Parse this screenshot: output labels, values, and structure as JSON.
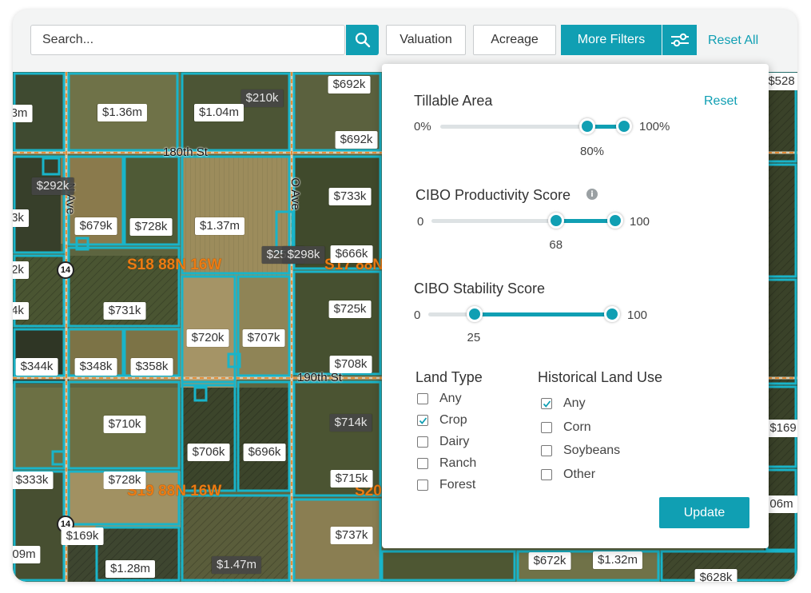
{
  "toolbar": {
    "search_placeholder": "Search...",
    "valuation_label": "Valuation",
    "acreage_label": "Acreage",
    "more_filters_label": "More Filters",
    "reset_all_label": "Reset All"
  },
  "map": {
    "roads": [
      "180th St",
      "190th St",
      "N Ave",
      "O Ave"
    ],
    "sections": [
      "S18 88N 16W",
      "S17 88N",
      "S19 88N 16W",
      "S20"
    ],
    "highway_shield": "14",
    "price_tags": [
      {
        "label": "$692k",
        "dark": false
      },
      {
        "label": "$528",
        "dark": false
      },
      {
        "label": "$210k",
        "dark": true
      },
      {
        "label": "3m",
        "dark": false
      },
      {
        "label": "$1.36m",
        "dark": false
      },
      {
        "label": "$1.04m",
        "dark": false
      },
      {
        "label": "$692k",
        "dark": false
      },
      {
        "label": "$292k",
        "dark": true
      },
      {
        "label": "$733k",
        "dark": false
      },
      {
        "label": "3k",
        "dark": false
      },
      {
        "label": "$679k",
        "dark": false
      },
      {
        "label": "$728k",
        "dark": false
      },
      {
        "label": "$1.37m",
        "dark": false
      },
      {
        "label": "$666k",
        "dark": false
      },
      {
        "label": "$252k",
        "dark": true
      },
      {
        "label": "$298k",
        "dark": true
      },
      {
        "label": "2k",
        "dark": false
      },
      {
        "label": "$731k",
        "dark": false
      },
      {
        "label": "4k",
        "dark": false
      },
      {
        "label": "$725k",
        "dark": false
      },
      {
        "label": "$720k",
        "dark": false
      },
      {
        "label": "$707k",
        "dark": false
      },
      {
        "label": "$344k",
        "dark": false
      },
      {
        "label": "$348k",
        "dark": false
      },
      {
        "label": "$358k",
        "dark": false
      },
      {
        "label": "$708k",
        "dark": false
      },
      {
        "label": "$710k",
        "dark": false
      },
      {
        "label": "$714k",
        "dark": true
      },
      {
        "label": "$706k",
        "dark": false
      },
      {
        "label": "$696k",
        "dark": false
      },
      {
        "label": "$333k",
        "dark": false
      },
      {
        "label": "$728k",
        "dark": false
      },
      {
        "label": "$715k",
        "dark": false
      },
      {
        "label": "$169k",
        "dark": false
      },
      {
        "label": "$737k",
        "dark": false
      },
      {
        "label": "09m",
        "dark": false
      },
      {
        "label": "$1.28m",
        "dark": false
      },
      {
        "label": "$1.47m",
        "dark": true
      },
      {
        "label": "$672k",
        "dark": false
      },
      {
        "label": "$1.32m",
        "dark": false
      },
      {
        "label": "$628k",
        "dark": false
      },
      {
        "label": "$169",
        "dark": false
      },
      {
        "label": "06m",
        "dark": false
      }
    ]
  },
  "panel": {
    "reset_label": "Reset",
    "tillable": {
      "title": "Tillable Area",
      "min_label": "0%",
      "max_label": "100%",
      "value_label": "80%",
      "value": 80,
      "min": 0,
      "max": 100
    },
    "productivity": {
      "title": "CIBO Productivity Score",
      "min_label": "0",
      "max_label": "100",
      "value_label": "68",
      "value": 68,
      "min": 0,
      "max": 100
    },
    "stability": {
      "title": "CIBO Stability Score",
      "min_label": "0",
      "max_label": "100",
      "value_label": "25",
      "value": 25,
      "min": 0,
      "max": 100
    },
    "land_type": {
      "title": "Land Type",
      "options": [
        {
          "label": "Any",
          "checked": false
        },
        {
          "label": "Crop",
          "checked": true
        },
        {
          "label": "Dairy",
          "checked": false
        },
        {
          "label": "Ranch",
          "checked": false
        },
        {
          "label": "Forest",
          "checked": false
        }
      ]
    },
    "historical": {
      "title": "Historical Land Use",
      "options": [
        {
          "label": "Any",
          "checked": true
        },
        {
          "label": "Corn",
          "checked": false
        },
        {
          "label": "Soybeans",
          "checked": false
        },
        {
          "label": "Other",
          "checked": false
        }
      ]
    },
    "update_label": "Update"
  },
  "colors": {
    "accent": "#109fb3",
    "parcel_outline": "#19b4c9",
    "section_label": "#ec7b13"
  }
}
